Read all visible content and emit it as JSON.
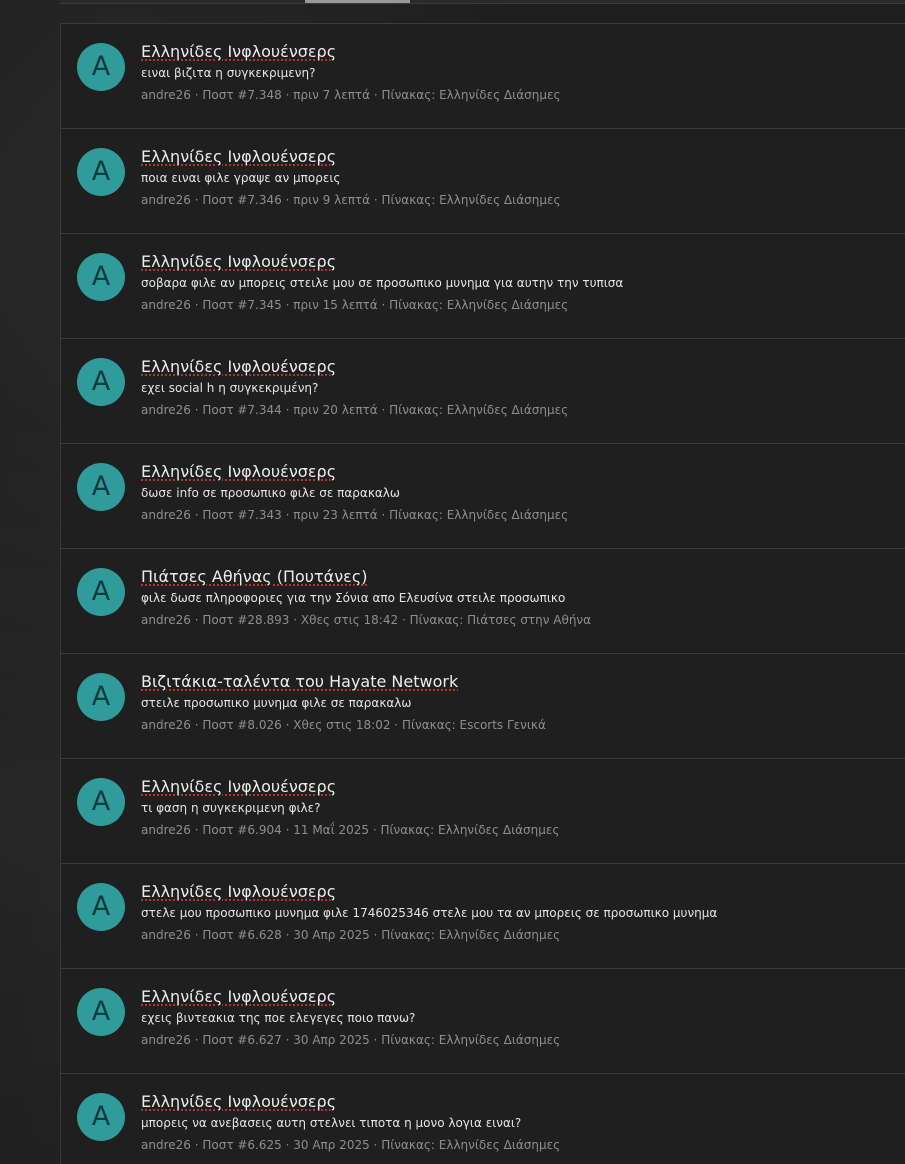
{
  "results": [
    {
      "avatar_letter": "A",
      "thread_title": "Ελληνίδες Ινφλουένσερς",
      "snippet": "ειναι βιζιτα η συγκεκριμενη?",
      "author": "andre26",
      "post": "Ποστ #7.348",
      "time": "πριν 7 λεπτά",
      "board": "Πίνακας: Ελληνίδες Διάσημες"
    },
    {
      "avatar_letter": "A",
      "thread_title": "Ελληνίδες Ινφλουένσερς",
      "snippet": "ποια ειναι φιλε γραψε αν μπορεις",
      "author": "andre26",
      "post": "Ποστ #7.346",
      "time": "πριν 9 λεπτά",
      "board": "Πίνακας: Ελληνίδες Διάσημες"
    },
    {
      "avatar_letter": "A",
      "thread_title": "Ελληνίδες Ινφλουένσερς",
      "snippet": "σοβαρα φιλε αν μπορεις στειλε μου σε προσωπικο μυνημα για αυτην την τυπισα",
      "author": "andre26",
      "post": "Ποστ #7.345",
      "time": "πριν 15 λεπτά",
      "board": "Πίνακας: Ελληνίδες Διάσημες"
    },
    {
      "avatar_letter": "A",
      "thread_title": "Ελληνίδες Ινφλουένσερς",
      "snippet": "εχει social h η συγκεκριμένη?",
      "author": "andre26",
      "post": "Ποστ #7.344",
      "time": "πριν 20 λεπτά",
      "board": "Πίνακας: Ελληνίδες Διάσημες"
    },
    {
      "avatar_letter": "A",
      "thread_title": "Ελληνίδες Ινφλουένσερς",
      "snippet": "δωσε info σε προσωπικο φιλε σε παρακαλω",
      "author": "andre26",
      "post": "Ποστ #7.343",
      "time": "πριν 23 λεπτά",
      "board": "Πίνακας: Ελληνίδες Διάσημες"
    },
    {
      "avatar_letter": "A",
      "thread_title": "Πιάτσες Αθήνας (Πουτάνες)",
      "snippet": "φιλε δωσε πληροφοριες για την Σόνια απο Ελευσίνα στειλε προσωπικο",
      "author": "andre26",
      "post": "Ποστ #28.893",
      "time": "Χθες στις 18:42",
      "board": "Πίνακας: Πιάτσες στην Αθήνα"
    },
    {
      "avatar_letter": "A",
      "thread_title": "Βιζιτάκια-ταλέντα του Hayate Network",
      "snippet": "στειλε προσωπικο μυνημα φιλε σε παρακαλω",
      "author": "andre26",
      "post": "Ποστ #8.026",
      "time": "Χθες στις 18:02",
      "board": "Πίνακας: Escorts Γενικά"
    },
    {
      "avatar_letter": "A",
      "thread_title": "Ελληνίδες Ινφλουένσερς",
      "snippet": "τι φαση η συγκεκριμενη φιλε?",
      "author": "andre26",
      "post": "Ποστ #6.904",
      "time": "11 Μαΐ 2025",
      "board": "Πίνακας: Ελληνίδες Διάσημες"
    },
    {
      "avatar_letter": "A",
      "thread_title": "Ελληνίδες Ινφλουένσερς",
      "snippet": "στελε μου προσωπικο μυνημα φιλε 1746025346 στελε μου τα αν μπορεις σε προσωπικο μυνημα",
      "author": "andre26",
      "post": "Ποστ #6.628",
      "time": "30 Απρ 2025",
      "board": "Πίνακας: Ελληνίδες Διάσημες"
    },
    {
      "avatar_letter": "A",
      "thread_title": "Ελληνίδες Ινφλουένσερς",
      "snippet": "εχεις βιντεακια της ποε ελεγεγες ποιο πανω?",
      "author": "andre26",
      "post": "Ποστ #6.627",
      "time": "30 Απρ 2025",
      "board": "Πίνακας: Ελληνίδες Διάσημες"
    },
    {
      "avatar_letter": "A",
      "thread_title": "Ελληνίδες Ινφλουένσερς",
      "snippet": "μπορεις να ανεβασεις αυτη στελνει τιποτα η μονο λογια ειναι?",
      "author": "andre26",
      "post": "Ποστ #6.625",
      "time": "30 Απρ 2025",
      "board": "Πίνακας: Ελληνίδες Διάσημες"
    }
  ],
  "separator": " · ",
  "colors": {
    "avatar_bg": "#2f9b9b",
    "avatar_text": "#0f3d3d",
    "panel_bg": "#1f1f1f",
    "meta_text": "#8e8e8e",
    "title_underline": "#d83a3a"
  }
}
